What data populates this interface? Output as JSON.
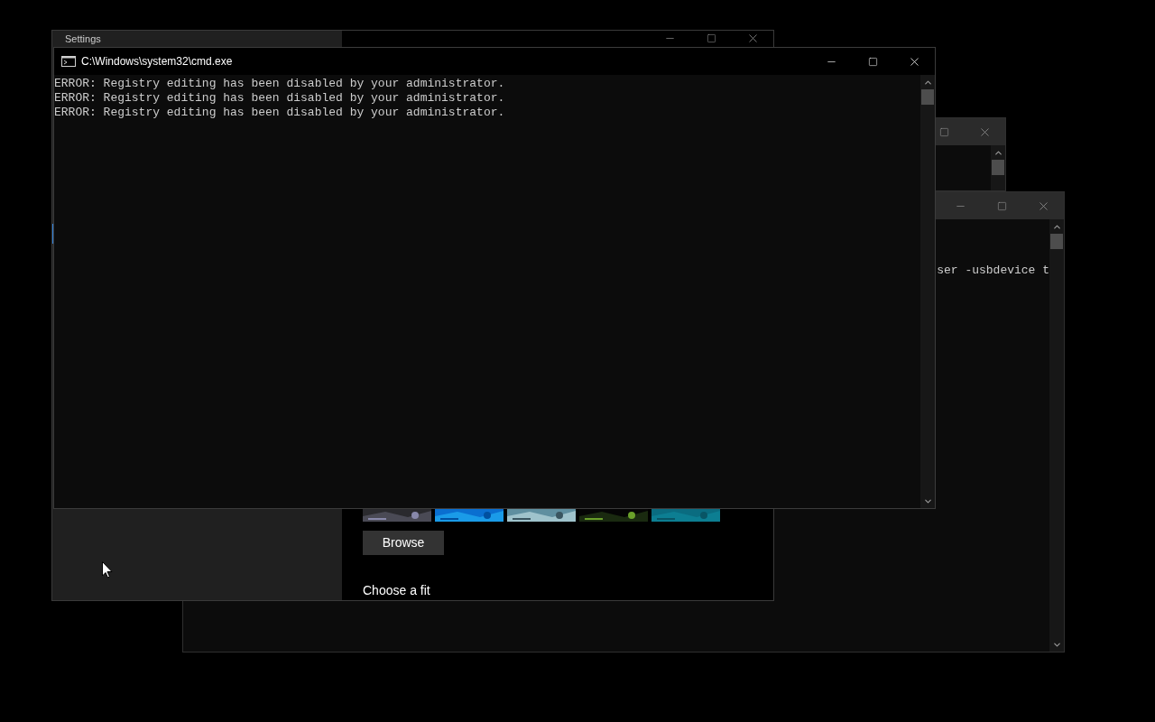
{
  "back_console": {
    "lines": [
      "ser -usbdevice t"
    ]
  },
  "settings_window": {
    "title": "Settings",
    "browse_button": "Browse",
    "fit_heading": "Choose a fit"
  },
  "console": {
    "title": "C:\\Windows\\system32\\cmd.exe",
    "lines": [
      "ERROR: Registry editing has been disabled by your administrator.",
      "ERROR: Registry editing has been disabled by your administrator.",
      "ERROR: Registry editing has been disabled by your administrator."
    ]
  }
}
